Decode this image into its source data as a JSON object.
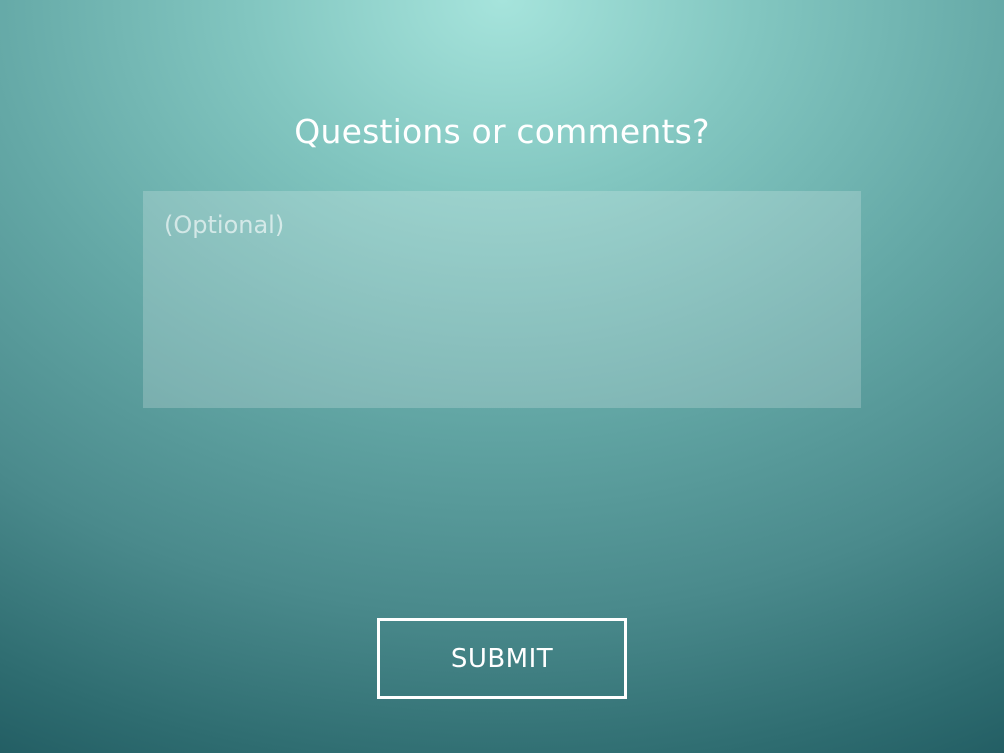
{
  "form": {
    "title": "Questions or comments?",
    "comment_field": {
      "value": "",
      "placeholder": "(Optional)"
    },
    "submit_label": "SUBMIT"
  },
  "colors": {
    "background_light": "#a6e4dc",
    "background_dark": "#1c555c",
    "text": "#ffffff"
  }
}
